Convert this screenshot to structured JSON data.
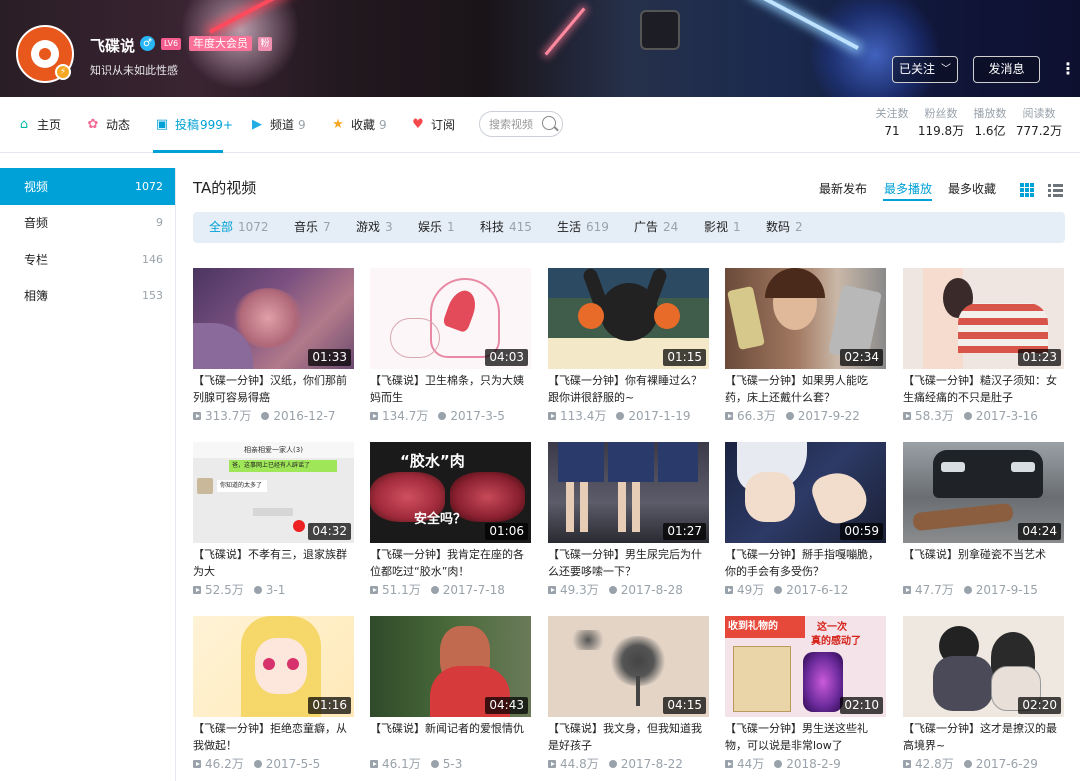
{
  "profile": {
    "name": "飞碟说",
    "level": "LV6",
    "vip": "年度大会员",
    "medal": "粉",
    "sign": "知识从未如此性感",
    "gender_icon": "male-icon",
    "followed_label": "已关注",
    "message_label": "发消息",
    "more_label": "⋮"
  },
  "nav": {
    "items": [
      {
        "label": "主页",
        "count": "",
        "icon": "home-icon",
        "color": "#00b5a4"
      },
      {
        "label": "动态",
        "count": "",
        "icon": "feed-icon",
        "color": "#f56996"
      },
      {
        "label": "投稿",
        "count": "999+",
        "icon": "upload-icon",
        "color": "#00a1d6"
      },
      {
        "label": "频道",
        "count": "9",
        "icon": "channel-icon",
        "color": "#23ade5"
      },
      {
        "label": "收藏",
        "count": "9",
        "icon": "star-icon",
        "color": "#f5a623"
      },
      {
        "label": "订阅",
        "count": "",
        "icon": "heart-icon",
        "color": "#f5484a"
      }
    ],
    "search_placeholder": "搜索视频"
  },
  "stats": [
    {
      "label": "关注数",
      "value": "71"
    },
    {
      "label": "粉丝数",
      "value": "119.8万"
    },
    {
      "label": "播放数",
      "value": "1.6亿"
    },
    {
      "label": "阅读数",
      "value": "777.2万"
    }
  ],
  "sidebar": {
    "items": [
      {
        "label": "视频",
        "count": "1072"
      },
      {
        "label": "音频",
        "count": "9"
      },
      {
        "label": "专栏",
        "count": "146"
      },
      {
        "label": "相簿",
        "count": "153"
      }
    ]
  },
  "main": {
    "title": "TA的视频",
    "sorts": [
      "最新发布",
      "最多播放",
      "最多收藏"
    ],
    "filters": [
      {
        "label": "全部",
        "count": "1072"
      },
      {
        "label": "音乐",
        "count": "7"
      },
      {
        "label": "游戏",
        "count": "3"
      },
      {
        "label": "娱乐",
        "count": "1"
      },
      {
        "label": "科技",
        "count": "415"
      },
      {
        "label": "生活",
        "count": "619"
      },
      {
        "label": "广告",
        "count": "24"
      },
      {
        "label": "影视",
        "count": "1"
      },
      {
        "label": "数码",
        "count": "2"
      }
    ]
  },
  "videos": [
    {
      "title": "【飞碟一分钟】汉纸，你们那前列腺可容易得癌",
      "duration": "01:33",
      "plays": "313.7万",
      "date": "2016-12-7"
    },
    {
      "title": "【飞碟说】卫生棉条，只为大姨妈而生",
      "duration": "04:03",
      "plays": "134.7万",
      "date": "2017-3-5"
    },
    {
      "title": "【飞碟一分钟】你有裸睡过么？跟你讲很舒服的~",
      "duration": "01:15",
      "plays": "113.4万",
      "date": "2017-1-19"
    },
    {
      "title": "【飞碟一分钟】如果男人能吃药，床上还戴什么套？",
      "duration": "02:34",
      "plays": "66.3万",
      "date": "2017-9-22"
    },
    {
      "title": "【飞碟一分钟】糙汉子须知：女生痛经痛的不只是肚子",
      "duration": "01:23",
      "plays": "58.3万",
      "date": "2017-3-16"
    },
    {
      "title": "【飞碟说】不孝有三，退家族群为大",
      "duration": "04:32",
      "plays": "52.5万",
      "date": "3-1"
    },
    {
      "title": "【飞碟一分钟】我肯定在座的各位都吃过“胶水”肉！",
      "duration": "01:06",
      "plays": "51.1万",
      "date": "2017-7-18"
    },
    {
      "title": "【飞碟一分钟】男生尿完后为什么还要哆嗦一下？",
      "duration": "01:27",
      "plays": "49.3万",
      "date": "2017-8-28"
    },
    {
      "title": "【飞碟一分钟】掰手指嘎嘣脆，你的手会有多受伤？",
      "duration": "00:59",
      "plays": "49万",
      "date": "2017-6-12"
    },
    {
      "title": "【飞碟说】别拿碰瓷不当艺术",
      "duration": "04:24",
      "plays": "47.7万",
      "date": "2017-9-15"
    },
    {
      "title": "【飞碟一分钟】拒绝恋童癖，从我做起！",
      "duration": "01:16",
      "plays": "46.2万",
      "date": "2017-5-5"
    },
    {
      "title": "【飞碟说】新闻记者的爱恨情仇",
      "duration": "04:43",
      "plays": "46.1万",
      "date": "5-3"
    },
    {
      "title": "【飞碟说】我文身，但我知道我是好孩子",
      "duration": "04:15",
      "plays": "44.8万",
      "date": "2017-8-22"
    },
    {
      "title": "【飞碟一分钟】男生送这些礼物，可以说是非常low了",
      "duration": "02:10",
      "plays": "44万",
      "date": "2018-2-9"
    },
    {
      "title": "【飞碟一分钟】这才是撩汉的最高境界~",
      "duration": "02:20",
      "plays": "42.8万",
      "date": "2017-6-29"
    }
  ],
  "thumb_text": {
    "chat_header": "相亲相爱一家人(3)",
    "chat_msg1": "爸，这事网上已经有人辟谣了",
    "chat_msg2": "你知道的太多了",
    "glue_line1": "“胶水”肉",
    "glue_line2": "安全吗？",
    "gift_line1": "收到礼物的",
    "gift_line2": "这一次",
    "gift_line3": "真的感动了"
  },
  "colors": {
    "accent": "#00a1d6",
    "pink": "#fb7299",
    "filter_bg": "#e5eef7",
    "muted": "#99a2aa"
  }
}
